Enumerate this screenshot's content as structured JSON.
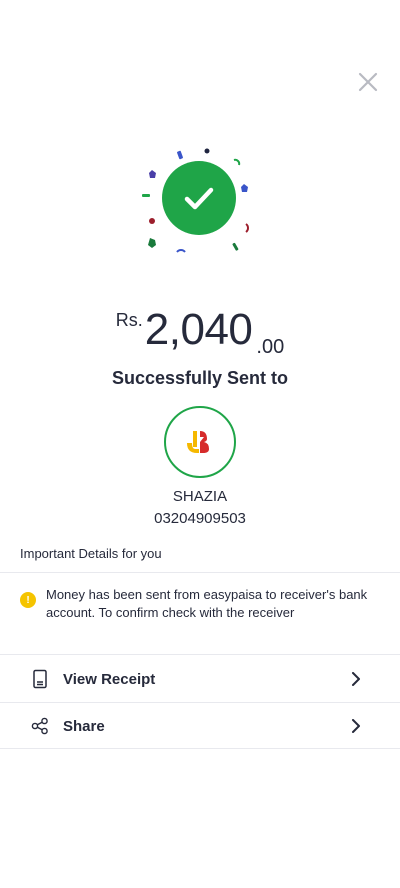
{
  "colors": {
    "success_green": "#1fa548",
    "text_dark": "#262a3b",
    "warning_yellow": "#f5c400",
    "divider": "#e8e9ee"
  },
  "header": {
    "close_icon": "close-icon"
  },
  "success": {
    "icon": "checkmark-icon"
  },
  "amount": {
    "currency": "Rs.",
    "whole": "2,040",
    "decimal": ".00"
  },
  "status_text": "Successfully Sent to",
  "recipient": {
    "avatar_icon": "bank-logo-icon",
    "name": "SHAZIA",
    "phone": "03204909503"
  },
  "details": {
    "title": "Important Details for you",
    "notice": "Money has been sent from easypaisa to receiver's bank account. To confirm check with the receiver"
  },
  "actions": [
    {
      "label": "View Receipt",
      "icon": "receipt-icon"
    },
    {
      "label": "Share",
      "icon": "share-icon"
    }
  ]
}
